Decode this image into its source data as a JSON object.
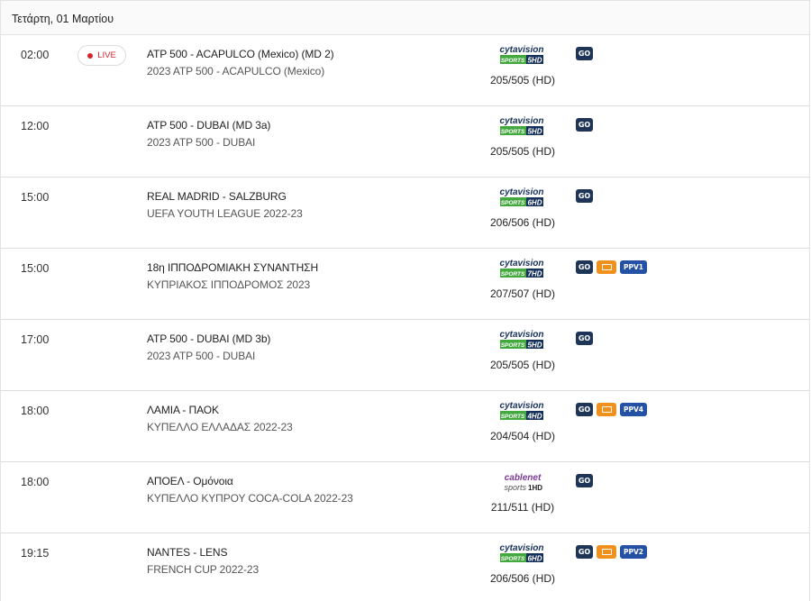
{
  "date_header": "Τετάρτη, 01 Μαρτίου",
  "live_label": "LIVE",
  "icons": {
    "go": "go-platform-icon",
    "tv": "tv-platform-icon",
    "ppv": "ppv-badge",
    "cytavision": "cytavision-sports-logo",
    "cablenet": "cablenet-sports-logo"
  },
  "colors": {
    "live": "#d9232e",
    "go_platform": "#1e3557",
    "tv_platform": "#f0911e",
    "ppv": "#2451a4",
    "cytavision_green": "#43a83e",
    "cytavision_navy": "#15305b",
    "cablenet_purple": "#7a3a95"
  },
  "events": [
    {
      "time": "02:00",
      "live": true,
      "title": "ATP 500 - ACAPULCO (Mexico) (MD 2)",
      "subtitle": "2023 ATP 500 - ACAPULCO (Mexico)",
      "channel_brand": "cytavision",
      "channel_logo_top": "cytavision",
      "channel_logo_bottom": "SPORTS",
      "channel_logo_num": "5HD",
      "channel_number": "205/505 (HD)",
      "platforms": [
        "GO"
      ],
      "ppv": ""
    },
    {
      "time": "12:00",
      "live": false,
      "title": "ATP 500 - DUBAI (MD 3a)",
      "subtitle": "2023 ATP 500 - DUBAI",
      "channel_brand": "cytavision",
      "channel_logo_top": "cytavision",
      "channel_logo_bottom": "SPORTS",
      "channel_logo_num": "5HD",
      "channel_number": "205/505 (HD)",
      "platforms": [
        "GO"
      ],
      "ppv": ""
    },
    {
      "time": "15:00",
      "live": false,
      "title": "REAL MADRID - SALZBURG",
      "subtitle": "UEFA YOUTH LEAGUE 2022-23",
      "channel_brand": "cytavision",
      "channel_logo_top": "cytavision",
      "channel_logo_bottom": "SPORTS",
      "channel_logo_num": "6HD",
      "channel_number": "206/506 (HD)",
      "platforms": [
        "GO"
      ],
      "ppv": ""
    },
    {
      "time": "15:00",
      "live": false,
      "title": "18η ΙΠΠΟΔΡΟΜΙΑΚΗ ΣΥΝΑΝΤΗΣΗ",
      "subtitle": "ΚΥΠΡΙΑΚΟΣ ΙΠΠΟΔΡΟΜΟΣ 2023",
      "channel_brand": "cytavision",
      "channel_logo_top": "cytavision",
      "channel_logo_bottom": "SPORTS",
      "channel_logo_num": "7HD",
      "channel_number": "207/507 (HD)",
      "platforms": [
        "GO",
        "TV"
      ],
      "ppv": "PPV1"
    },
    {
      "time": "17:00",
      "live": false,
      "title": "ATP 500 - DUBAI (MD 3b)",
      "subtitle": "2023 ATP 500 - DUBAI",
      "channel_brand": "cytavision",
      "channel_logo_top": "cytavision",
      "channel_logo_bottom": "SPORTS",
      "channel_logo_num": "5HD",
      "channel_number": "205/505 (HD)",
      "platforms": [
        "GO"
      ],
      "ppv": ""
    },
    {
      "time": "18:00",
      "live": false,
      "title": "ΛΑΜΙΑ - ΠΑΟΚ",
      "subtitle": "ΚΥΠΕΛΛΟ ΕΛΛΑΔΑΣ 2022-23",
      "channel_brand": "cytavision",
      "channel_logo_top": "cytavision",
      "channel_logo_bottom": "SPORTS",
      "channel_logo_num": "4HD",
      "channel_number": "204/504 (HD)",
      "platforms": [
        "GO",
        "TV"
      ],
      "ppv": "PPV4"
    },
    {
      "time": "18:00",
      "live": false,
      "title": "ΑΠΟΕΛ - Ομόνοια",
      "subtitle": "ΚΥΠΕΛΛΟ ΚΥΠΡΟΥ COCA-COLA 2022-23",
      "channel_brand": "cablenet",
      "channel_logo_top": "cablenet",
      "channel_logo_bottom": "sports",
      "channel_logo_num": "1HD",
      "channel_number": "211/511 (HD)",
      "platforms": [
        "GO"
      ],
      "ppv": ""
    },
    {
      "time": "19:15",
      "live": false,
      "title": "NANTES - LENS",
      "subtitle": "FRENCH CUP 2022-23",
      "channel_brand": "cytavision",
      "channel_logo_top": "cytavision",
      "channel_logo_bottom": "SPORTS",
      "channel_logo_num": "6HD",
      "channel_number": "206/506 (HD)",
      "platforms": [
        "GO",
        "TV"
      ],
      "ppv": "PPV2"
    }
  ]
}
